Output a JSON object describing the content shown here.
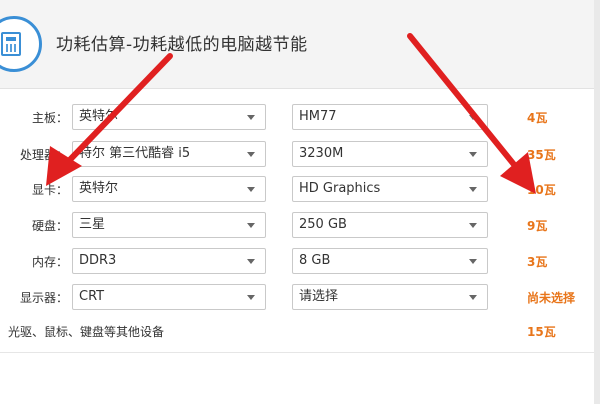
{
  "header": {
    "title": "功耗估算-功耗越低的电脑越节能",
    "icon": "calculator-icon"
  },
  "rows": [
    {
      "label": "主板：",
      "brand": "英特尔",
      "model": "HM77",
      "watt": "4瓦"
    },
    {
      "label": "处理器：",
      "brand": "特尔 第三代酷睿 i5",
      "model": "3230M",
      "watt": "35瓦"
    },
    {
      "label": "显卡：",
      "brand": "英特尔",
      "model": "HD Graphics",
      "watt": "10瓦"
    },
    {
      "label": "硬盘：",
      "brand": "三星",
      "model": "250 GB",
      "watt": "9瓦"
    },
    {
      "label": "内存：",
      "brand": "DDR3",
      "model": "8 GB",
      "watt": "3瓦"
    },
    {
      "label": "显示器：",
      "brand": "CRT",
      "model": "请选择",
      "watt": "尚未选择"
    }
  ],
  "other": {
    "label": "光驱、鼠标、键盘等其他设备",
    "watt": "15瓦"
  },
  "footer": {
    "text": ""
  },
  "colors": {
    "accent": "#3a8fd6",
    "watt": "#e8751a",
    "annotation_arrow": "#e02020"
  }
}
